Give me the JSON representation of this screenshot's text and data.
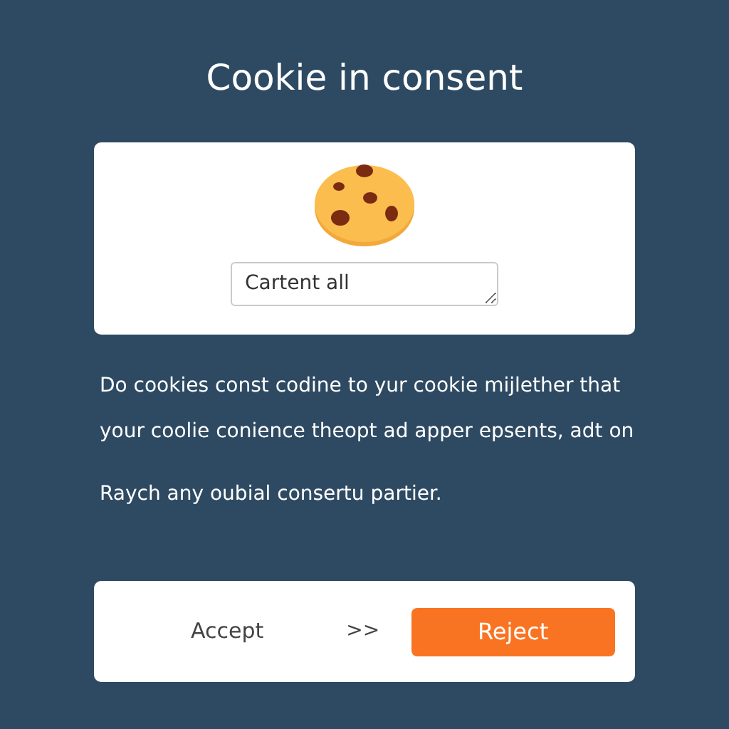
{
  "title": "Cookie in consent",
  "consent_card": {
    "field": {
      "value": "Cartent all"
    }
  },
  "message_lines": [
    "Do cookies const codine to yur cookie mijlether that",
    "your coolie conience theopt ad apper epsents, adt on",
    "Raych any oubial consertu partier."
  ],
  "actions": [
    {
      "kind": "text",
      "label": "Accept"
    },
    {
      "kind": "arrow",
      "label": ">>"
    },
    {
      "kind": "primary",
      "label": "Reject"
    }
  ]
}
